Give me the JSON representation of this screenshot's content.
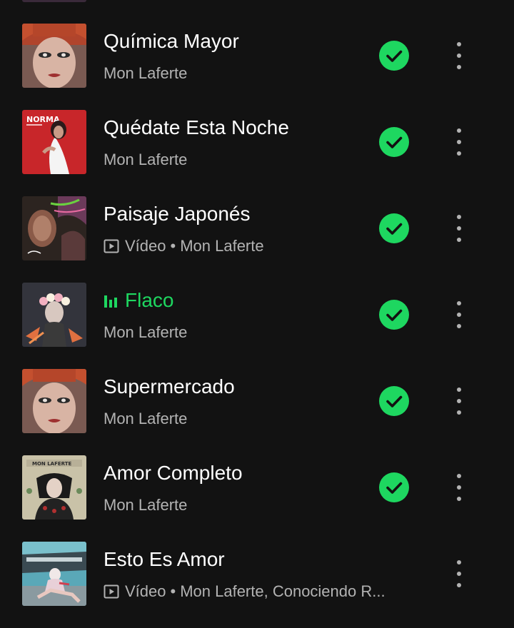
{
  "tracks": [
    {
      "title": "Química Mayor",
      "subtitle": "Mon Laferte",
      "video": false,
      "video_label": "",
      "artists": "",
      "playing": false,
      "downloaded": true,
      "cover": "quimica-mayor-cover"
    },
    {
      "title": "Quédate Esta Noche",
      "subtitle": "Mon Laferte",
      "video": false,
      "video_label": "",
      "artists": "",
      "playing": false,
      "downloaded": true,
      "cover": "norma-cover",
      "cover_text": "NORMA"
    },
    {
      "title": "Paisaje Japonés",
      "subtitle": "",
      "video": true,
      "video_label": "Vídeo",
      "artists": "Mon Laferte",
      "playing": false,
      "downloaded": true,
      "cover": "paisaje-japones-cover"
    },
    {
      "title": "Flaco",
      "subtitle": "Mon Laferte",
      "video": false,
      "video_label": "",
      "artists": "",
      "playing": true,
      "downloaded": true,
      "cover": "flaco-cover"
    },
    {
      "title": "Supermercado",
      "subtitle": "Mon Laferte",
      "video": false,
      "video_label": "",
      "artists": "",
      "playing": false,
      "downloaded": true,
      "cover": "supermercado-cover"
    },
    {
      "title": "Amor Completo",
      "subtitle": "Mon Laferte",
      "video": false,
      "video_label": "",
      "artists": "",
      "playing": false,
      "downloaded": true,
      "cover": "amor-completo-cover",
      "cover_text": "MON LAFERTE"
    },
    {
      "title": "Esto Es Amor",
      "subtitle": "",
      "video": true,
      "video_label": "Vídeo",
      "artists": "Mon Laferte, Conociendo R...",
      "playing": false,
      "downloaded": false,
      "cover": "esto-es-amor-cover"
    }
  ],
  "separator": "•",
  "colors": {
    "background": "#121212",
    "accent": "#1ed760",
    "primary_text": "#ffffff",
    "secondary_text": "#b3b3b3"
  }
}
